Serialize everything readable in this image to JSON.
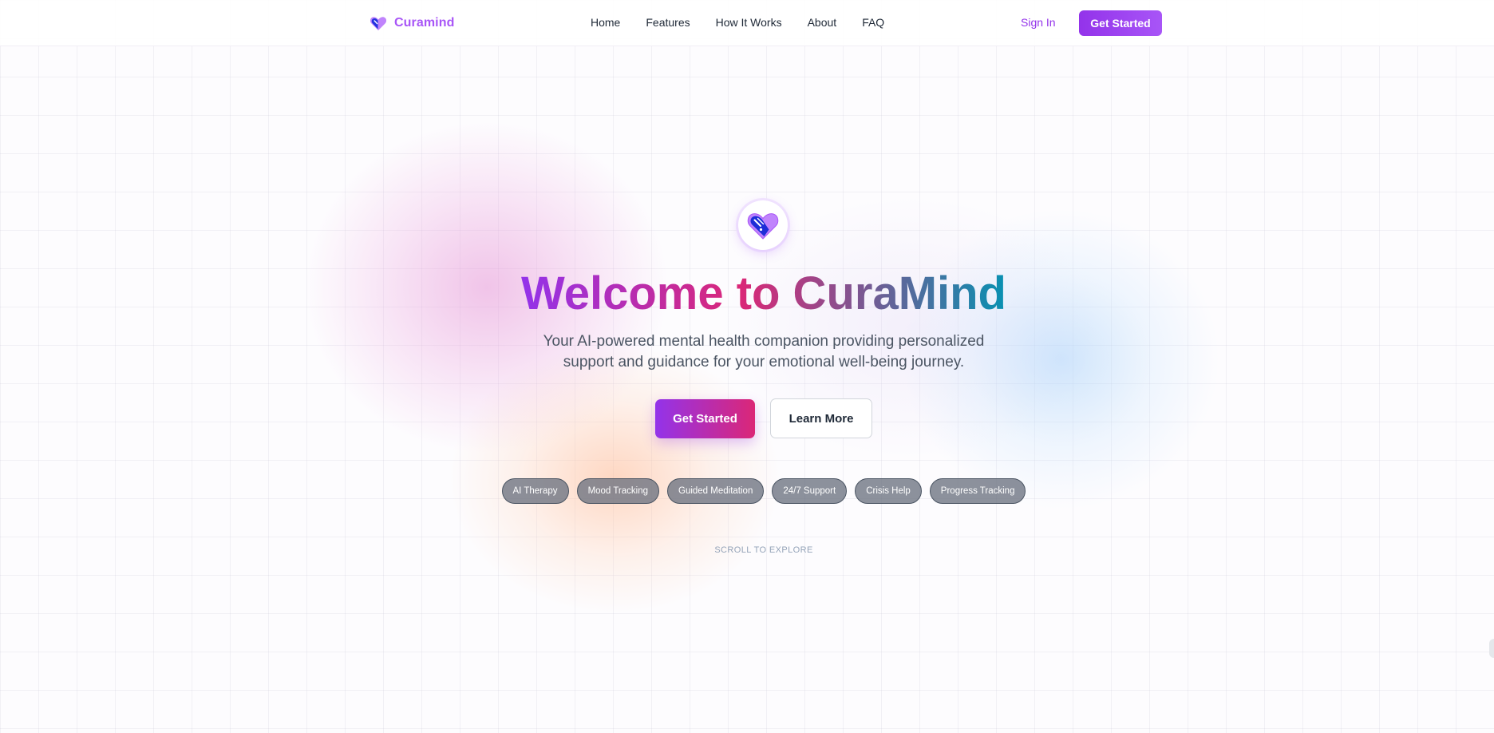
{
  "header": {
    "brand_name": "Curamind",
    "brand_icon": "heart-logo-icon",
    "nav": [
      "Home",
      "Features",
      "How It Works",
      "About",
      "FAQ"
    ],
    "sign_in_label": "Sign In",
    "cta_label": "Get Started"
  },
  "hero": {
    "logo_icon": "heart-logo-icon",
    "title": "Welcome to CuraMind",
    "subtitle": "Your AI-powered mental health companion providing personalized support and guidance for your emotional well-being journey.",
    "primary_cta": "Get Started",
    "secondary_cta": "Learn More",
    "tags": [
      "AI Therapy",
      "Mood Tracking",
      "Guided Meditation",
      "24/7 Support",
      "Crisis Help",
      "Progress Tracking"
    ],
    "scroll_hint": "SCROLL TO EXPLORE"
  },
  "colors": {
    "brand_purple": "#a855f7",
    "deep_purple": "#9333ea",
    "pink": "#db2777",
    "teal": "#0891b2",
    "logo_blue": "#1d2dd8"
  }
}
